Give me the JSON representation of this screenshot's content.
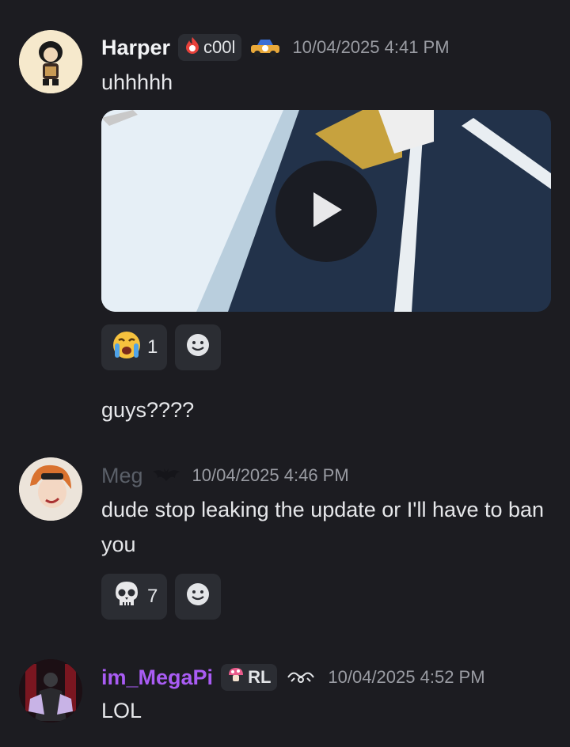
{
  "messages": [
    {
      "username": "Harper",
      "tag": "c00l",
      "timestamp": "10/04/2025 4:41 PM",
      "text": "uhhhhh",
      "video": {
        "play_icon": "play-icon"
      },
      "reactions": [
        {
          "emoji": "loudly-crying-face",
          "count": "1"
        }
      ]
    },
    {
      "text": "guys????"
    },
    {
      "username": "Meg",
      "timestamp": "10/04/2025 4:46 PM",
      "text": "dude stop leaking the update or I'll have to ban you",
      "reactions": [
        {
          "emoji": "skull",
          "count": "7"
        }
      ]
    },
    {
      "username": "im_MegaPi",
      "tag": "RL",
      "timestamp": "10/04/2025 4:52 PM",
      "text": "LOL"
    }
  ],
  "colors": {
    "background": "#1c1c21",
    "username_purple": "#a95cf4",
    "timestamp": "#9a9ca3",
    "chip": "#2b2d33"
  }
}
